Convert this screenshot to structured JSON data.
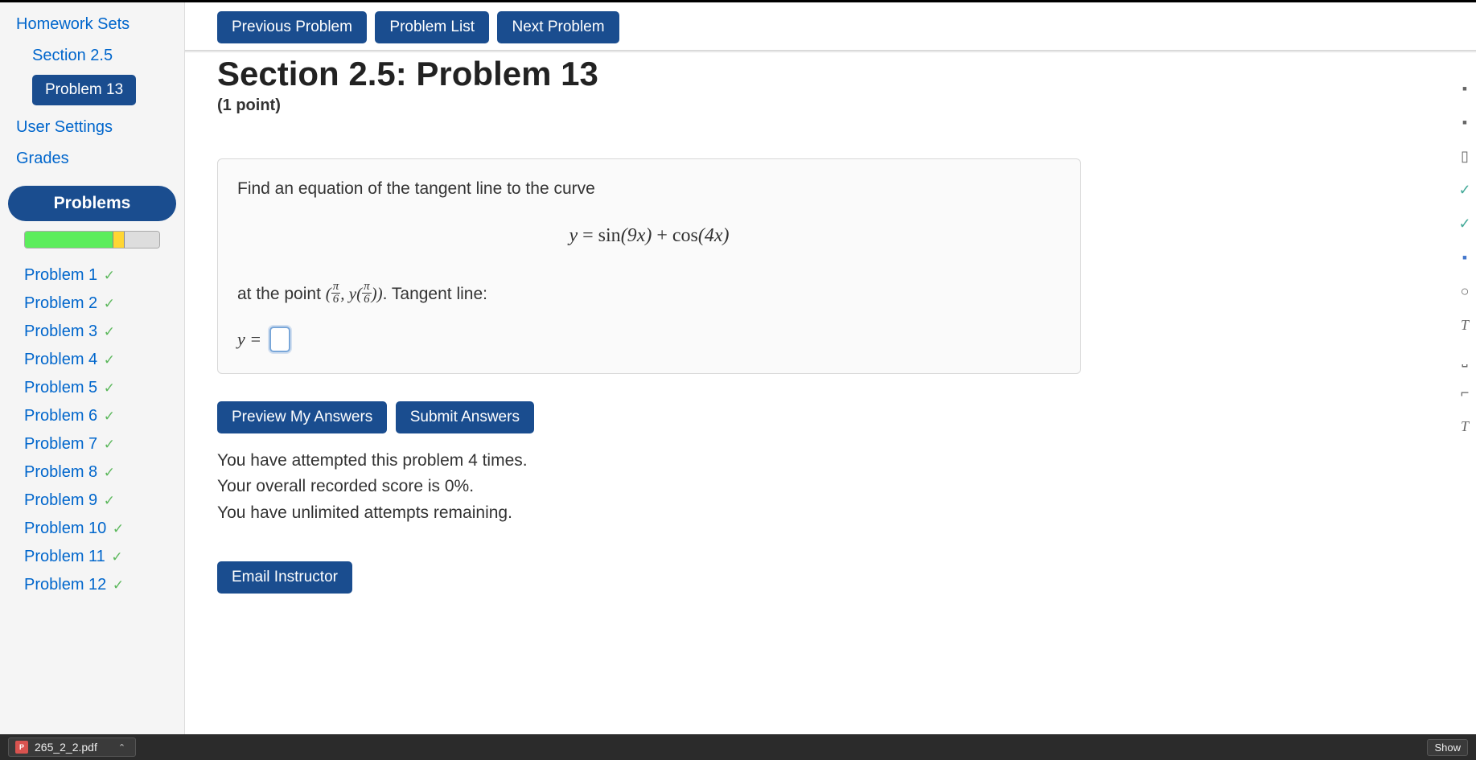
{
  "sidebar": {
    "nav": {
      "homework_sets": "Homework Sets",
      "section": "Section 2.5",
      "current_problem": "Problem 13",
      "user_settings": "User Settings",
      "grades": "Grades"
    },
    "problems_header": "Problems",
    "problems": [
      {
        "label": "Problem 1",
        "status": "✓"
      },
      {
        "label": "Problem 2",
        "status": "✓"
      },
      {
        "label": "Problem 3",
        "status": "✓"
      },
      {
        "label": "Problem 4",
        "status": "✓"
      },
      {
        "label": "Problem 5",
        "status": "✓"
      },
      {
        "label": "Problem 6",
        "status": "✓"
      },
      {
        "label": "Problem 7",
        "status": "✓"
      },
      {
        "label": "Problem 8",
        "status": "✓"
      },
      {
        "label": "Problem 9",
        "status": "✓"
      },
      {
        "label": "Problem 10",
        "status": "✓"
      },
      {
        "label": "Problem 11",
        "status": "✓"
      },
      {
        "label": "Problem 12",
        "status": "✓"
      }
    ]
  },
  "nav_buttons": {
    "prev": "Previous Problem",
    "list": "Problem List",
    "next": "Next Problem"
  },
  "header": {
    "title": "Section 2.5: Problem 13",
    "points": "(1 point)"
  },
  "problem": {
    "prompt": "Find an equation of the tangent line to the curve",
    "equation": {
      "lhs": "y",
      "eq": " = ",
      "rhs": "sin(9x) + cos(4x)"
    },
    "at_point_prefix": "at the point ",
    "at_point_paren_open": "(",
    "frac1_num": "π",
    "frac1_den": "6",
    "comma": ",  ",
    "y_of": "y",
    "paren_open2": "(",
    "frac2_num": "π",
    "frac2_den": "6",
    "paren_close2": ")",
    "paren_close": ")",
    "tangent_suffix": ". Tangent line:",
    "answer_prefix": "y ="
  },
  "actions": {
    "preview": "Preview My Answers",
    "submit": "Submit Answers",
    "email": "Email Instructor"
  },
  "status": {
    "attempts": "You have attempted this problem 4 times.",
    "score": "Your overall recorded score is 0%.",
    "remaining": "You have unlimited attempts remaining."
  },
  "download": {
    "file": "265_2_2.pdf",
    "show_all": "Show"
  }
}
